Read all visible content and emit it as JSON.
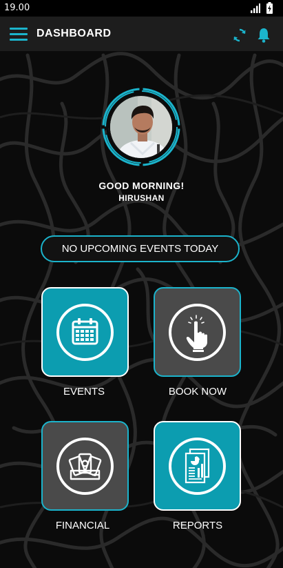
{
  "status_bar": {
    "time": "19.00"
  },
  "app_bar": {
    "title": "DASHBOARD",
    "icons": [
      "menu-icon",
      "sync-icon",
      "bell-icon"
    ],
    "accent": "#1bb4cc"
  },
  "profile": {
    "greeting": "GOOD MORNING!",
    "name": "HIRUSHAN"
  },
  "events_banner": "NO UPCOMING EVENTS TODAY",
  "tiles": [
    {
      "label": "EVENTS",
      "icon": "calendar-icon",
      "color": "#0c9db0"
    },
    {
      "label": "BOOK NOW",
      "icon": "touch-icon",
      "color": "#4a4a4a"
    },
    {
      "label": "FINANCIAL",
      "icon": "wallet-icon",
      "color": "#4a4a4a"
    },
    {
      "label": "REPORTS",
      "icon": "report-icon",
      "color": "#0c9db0"
    }
  ]
}
